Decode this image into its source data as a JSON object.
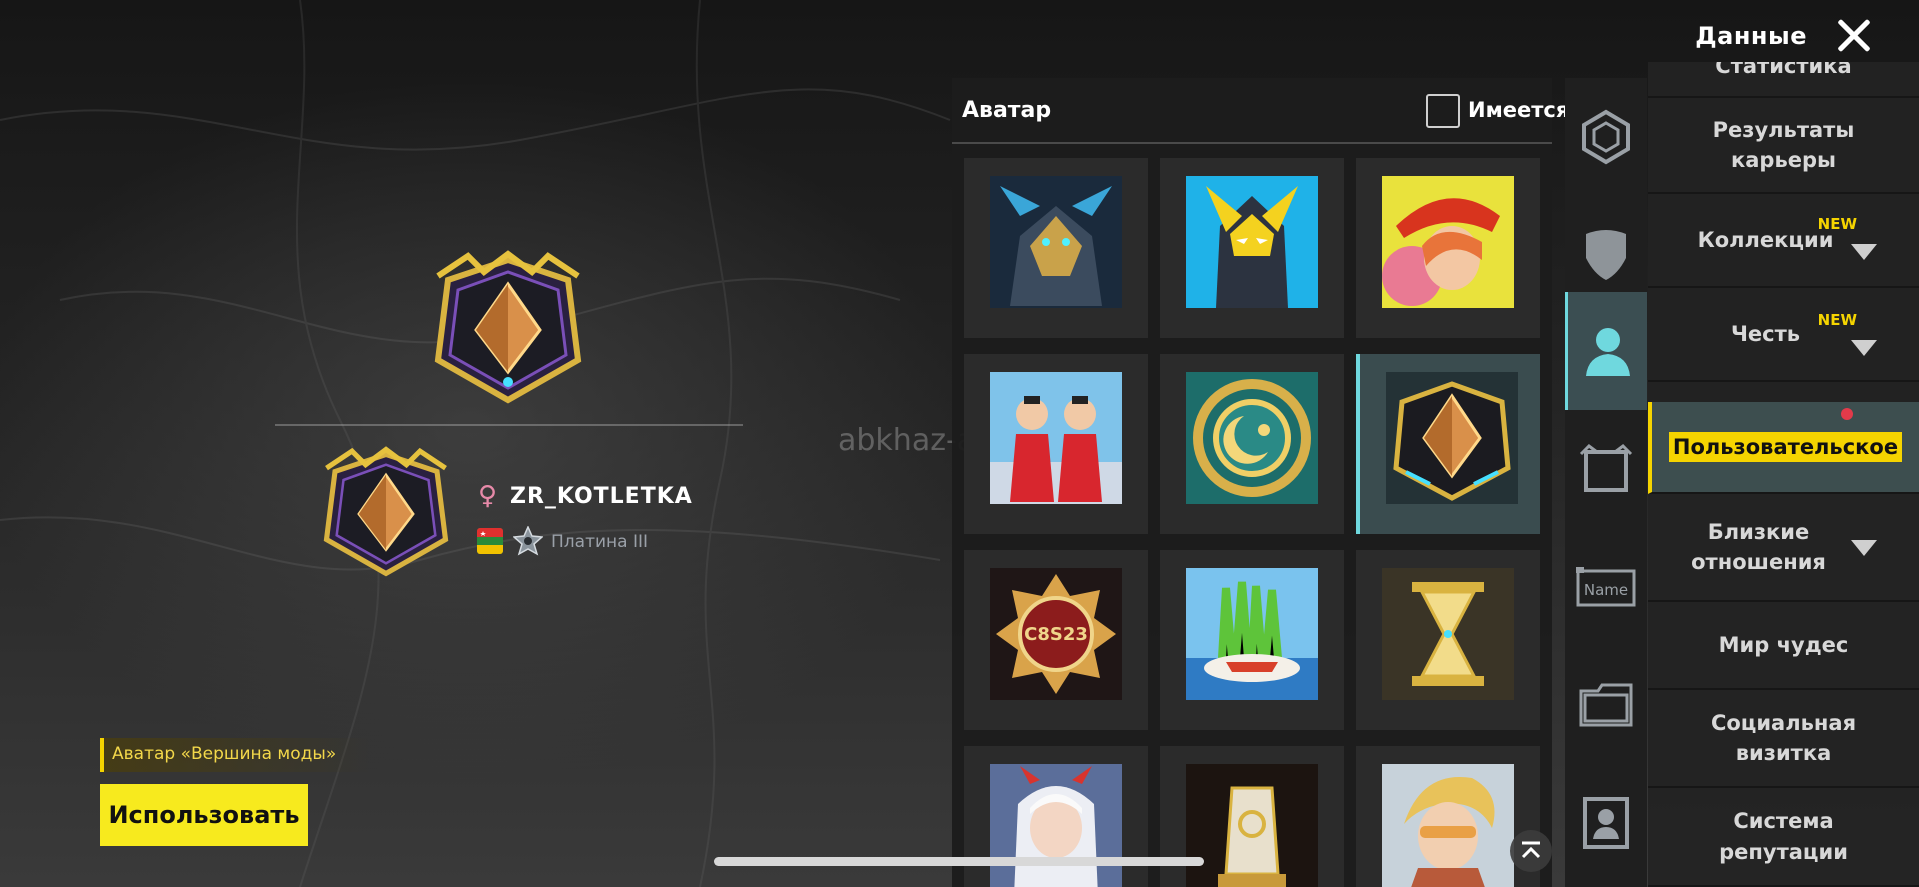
{
  "header": {
    "title": "Данные",
    "close_icon": "close-icon"
  },
  "preview": {
    "player_name": "ZR_KOTLETKA",
    "gender_icon": "female-icon",
    "gender_symbol": "♀",
    "rank": "Платина III",
    "watermark": "abkhaz-auto.com"
  },
  "action": {
    "item_caption": "Аватар «Вершина моды»",
    "use_label": "Использовать"
  },
  "grid": {
    "title": "Аватар",
    "filter_label": "Имеется",
    "filter_checked": false,
    "items": [
      {
        "name": "avatar-armored-dragon"
      },
      {
        "name": "avatar-yellow-mask-hero"
      },
      {
        "name": "avatar-red-hat-girl"
      },
      {
        "name": "avatar-red-duo"
      },
      {
        "name": "avatar-golden-moon-emblem"
      },
      {
        "name": "avatar-fashion-peak-badge",
        "selected": true
      },
      {
        "name": "avatar-c8s23-emblem"
      },
      {
        "name": "avatar-grass-tray"
      },
      {
        "name": "avatar-golden-hourglass"
      },
      {
        "name": "avatar-white-hair-girl"
      },
      {
        "name": "avatar-anniversary-trophy"
      },
      {
        "name": "avatar-blond-sunglasses-man"
      }
    ]
  },
  "rail": [
    {
      "icon": "frame-icon"
    },
    {
      "icon": "shield-icon"
    },
    {
      "icon": "person-icon",
      "active": true
    },
    {
      "icon": "square-frame-icon"
    },
    {
      "icon": "name-tag-icon",
      "label": "Name"
    },
    {
      "icon": "folder-icon"
    },
    {
      "icon": "id-card-icon"
    }
  ],
  "menu": {
    "items": [
      {
        "label": "Статистика"
      },
      {
        "label": "Результаты карьеры"
      },
      {
        "label": "Коллекции",
        "badge": "NEW",
        "expandable": true
      },
      {
        "label": "Честь",
        "badge": "NEW",
        "expandable": true
      },
      {
        "label": "Пользовательское",
        "active": true
      },
      {
        "label": "Близкие отношения",
        "expandable": true
      },
      {
        "label": "Мир чудес"
      },
      {
        "label": "Социальная визитка"
      },
      {
        "label": "Система репутации"
      }
    ]
  },
  "colors": {
    "accent": "#f5d400",
    "teal": "#6fd8de",
    "panel": "#1c1c1c"
  }
}
